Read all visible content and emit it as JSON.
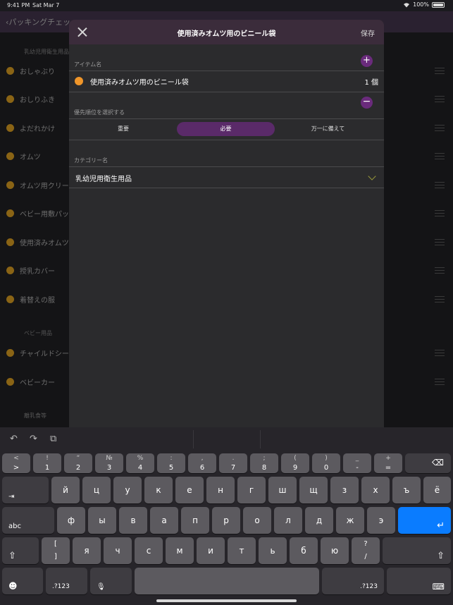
{
  "status": {
    "time": "9:41 PM",
    "date": "Sat Mar 7",
    "battery": "100%"
  },
  "background": {
    "back_label": "パッキングチェッ",
    "sections": [
      {
        "name": "乳幼児用衛生用品",
        "items": [
          "おしゃぶり",
          "おしりふき",
          "よだれかけ",
          "オムツ",
          "オムツ用クリー",
          "ベビー用敷パッ",
          "使用済みオムツ",
          "授乳カバー",
          "着替えの服"
        ]
      },
      {
        "name": "ベビー用品",
        "items": [
          "チャイルドシー",
          "ベビーカー"
        ]
      },
      {
        "name": "離乳食等",
        "items": []
      }
    ]
  },
  "modal": {
    "title": "使用済みオムツ用のビニール袋",
    "save_label": "保存",
    "item_label": "アイテム名",
    "item_name": "使用済みオムツ用のビニール袋",
    "item_qty": "1 個",
    "plus_glyph": "+",
    "minus_glyph": "−",
    "priority_label": "優先順位を選択する",
    "priority_options": [
      "重要",
      "必要",
      "万一に備えて"
    ],
    "priority_selected": "必要",
    "category_label": "カテゴリー名",
    "category_value": "乳幼児用衛生用品",
    "colors": {
      "header": "#3b2c3b",
      "accent": "#6a2b7c",
      "item_dot": "#f0962a",
      "selected_segment": "#5a2a69"
    }
  },
  "keyboard": {
    "toolbar": {
      "undo": "↶",
      "redo": "↷",
      "paste": "⧉"
    },
    "row1": [
      {
        "top": "<",
        "bot": ">"
      },
      {
        "top": "!",
        "bot": "1"
      },
      {
        "top": "“",
        "bot": "2"
      },
      {
        "top": "№",
        "bot": "3"
      },
      {
        "top": "%",
        "bot": "4"
      },
      {
        "top": ":",
        "bot": "5"
      },
      {
        "top": ",",
        "bot": "6"
      },
      {
        "top": ".",
        "bot": "7"
      },
      {
        "top": ";",
        "bot": "8"
      },
      {
        "top": "(",
        "bot": "9"
      },
      {
        "top": ")",
        "bot": "0"
      },
      {
        "top": "_",
        "bot": "-"
      },
      {
        "top": "+",
        "bot": "="
      }
    ],
    "delete_glyph": "⌫",
    "tab_glyph": "⇥",
    "row2": [
      "й",
      "ц",
      "у",
      "к",
      "е",
      "н",
      "г",
      "ш",
      "щ",
      "з",
      "х",
      "ъ",
      "ё"
    ],
    "caps_label": "abc",
    "row3": [
      "ф",
      "ы",
      "в",
      "а",
      "п",
      "р",
      "о",
      "л",
      "д",
      "ж",
      "э"
    ],
    "return_glyph": "↵",
    "shift_glyph": "⇧",
    "row4_bracket": {
      "top": "[",
      "bot": "]"
    },
    "row4": [
      "я",
      "ч",
      "с",
      "м",
      "и",
      "т",
      "ь",
      "б",
      "ю"
    ],
    "row4_question": {
      "top": "?",
      "bot": "/"
    },
    "emoji_glyph": "☻",
    "numbers_label": ".?123",
    "mic_glyph": "🎙",
    "hide_glyph": "⌨"
  }
}
